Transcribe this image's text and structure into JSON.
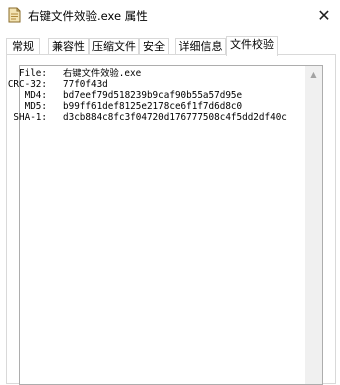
{
  "window": {
    "title": "右键文件效验.exe 属性",
    "close_glyph": "✕",
    "app_icon": "document-icon"
  },
  "tabs": [
    {
      "label": "常规"
    },
    {
      "label": "兼容性"
    },
    {
      "label": "压缩文件"
    },
    {
      "label": "安全"
    },
    {
      "label": "详细信息"
    },
    {
      "label": "文件校验",
      "active": true
    }
  ],
  "hashes": {
    "rows": [
      {
        "label": "File:",
        "value": "右键文件效验.exe"
      },
      {
        "label": "CRC-32:",
        "value": "77f0f43d"
      },
      {
        "label": "MD4:",
        "value": "bd7eef79d518239b9caf90b55a57d95e"
      },
      {
        "label": "MD5:",
        "value": "b99ff61def8125e2178ce6f1f7d6d8c0"
      },
      {
        "label": "SHA-1:",
        "value": "d3cb884c8fc3f04720d176777508c4f5dd2df40c"
      }
    ]
  },
  "scrollbar": {
    "up_glyph": "▲"
  }
}
